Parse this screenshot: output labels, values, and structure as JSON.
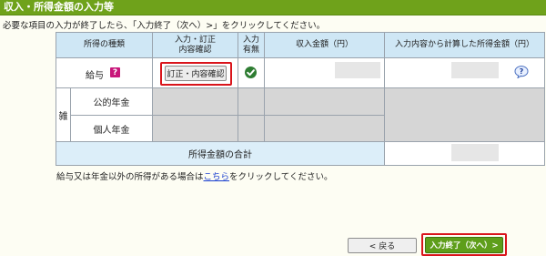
{
  "page": {
    "title": "収入・所得金額の入力等",
    "instruction": "必要な項目の入力が終了したら、「入力終了（次へ）>」をクリックしてください。"
  },
  "table": {
    "headers": {
      "type": "所得の種類",
      "entry": "入力・訂正\n内容確認",
      "status": "入力\n有無",
      "income": "収入金額（円）",
      "calculated": "入力内容から計算した所得金額（円）"
    },
    "rows": {
      "salary": {
        "label": "給与",
        "help_icon": "question-icon",
        "button_label": "訂正・内容確認",
        "status_icon": "check-icon"
      },
      "misc_group_label": "雑",
      "pension": {
        "label": "公的年金"
      },
      "individual_pension": {
        "label": "個人年金"
      },
      "total": {
        "label": "所得金額の合計"
      }
    }
  },
  "note": {
    "prefix": "給与又は年金以外の所得がある場合は",
    "link": "こちら",
    "suffix": "をクリックしてください。"
  },
  "footer": {
    "back_label": "< 戻る",
    "next_label": "入力終了（次へ）>"
  },
  "colors": {
    "title_bar": "#6fa21b",
    "header_bg": "#cfe7f5",
    "highlight": "#d9141b",
    "next_button": "#5e9e1a"
  }
}
